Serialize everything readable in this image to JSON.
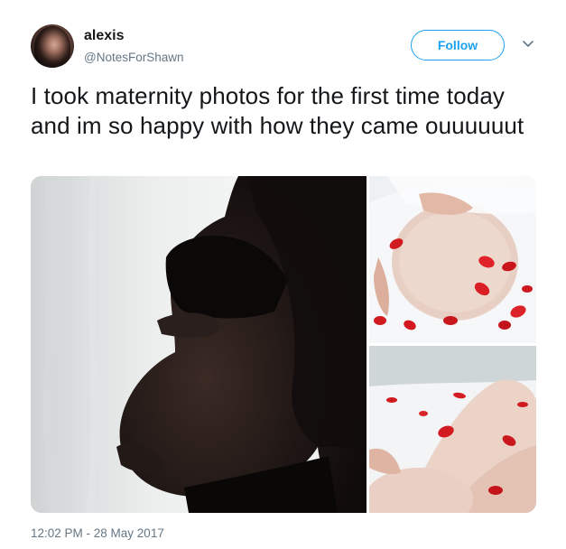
{
  "user": {
    "display_name": "alexis",
    "handle": "@NotesForShawn",
    "avatar_icon": "profile-photo"
  },
  "actions": {
    "follow_label": "Follow",
    "menu_icon": "chevron-down-icon"
  },
  "tweet": {
    "text": "I took maternity photos for the first time today and im so happy with how they came ouuuuuut",
    "timestamp": "12:02 PM - 28 May 2017"
  },
  "media": {
    "count": 3
  },
  "colors": {
    "accent": "#1da1f2",
    "text_primary": "#14171a",
    "text_secondary": "#657786"
  }
}
